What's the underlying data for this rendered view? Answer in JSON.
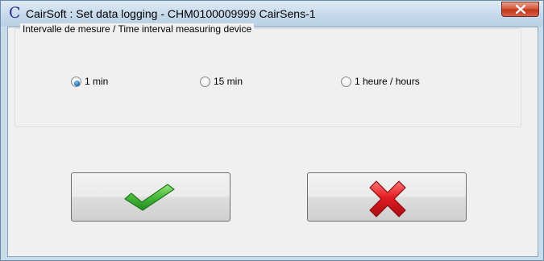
{
  "window": {
    "title": "CairSoft : Set data logging - CHM0100009999 CairSens-1",
    "app_icon": "C"
  },
  "group": {
    "label": "Intervalle de mesure / Time interval measuring device"
  },
  "options": [
    {
      "label": "1 min",
      "selected": true
    },
    {
      "label": "15 min",
      "selected": false
    },
    {
      "label": "1 heure / hours",
      "selected": false
    }
  ],
  "buttons": {
    "ok_icon": "green-checkmark-icon",
    "cancel_icon": "red-cross-icon"
  },
  "colors": {
    "check_green": "#3fb33a",
    "cross_red": "#d8161c",
    "close_red": "#c7391c"
  }
}
